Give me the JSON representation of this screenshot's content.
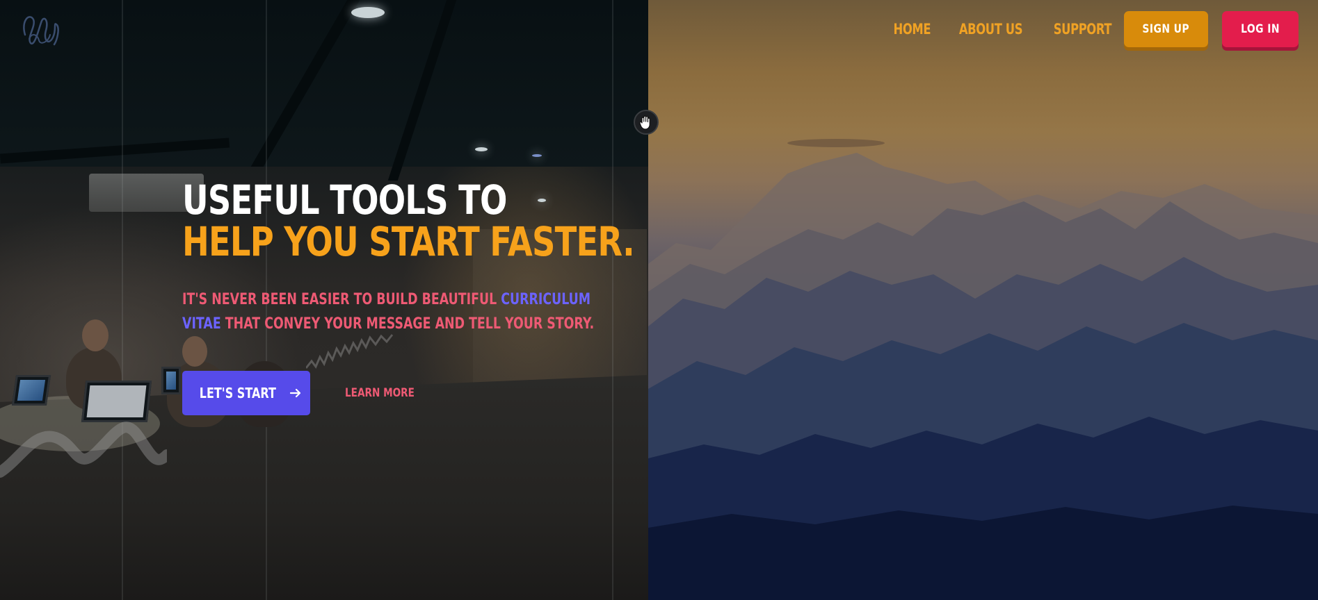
{
  "nav": {
    "links": [
      "HOME",
      "ABOUT US",
      "SUPPORT"
    ],
    "signup_label": "SIGN UP",
    "login_label": "LOG IN"
  },
  "hero": {
    "title_line1": "USEFUL TOOLS TO",
    "title_line2": "HELP YOU START FASTER.",
    "desc_before": "IT'S NEVER BEEN EASIER TO BUILD BEAUTIFUL ",
    "desc_highlight": "CURRICULUM VITAE",
    "desc_after": " THAT CONVEY YOUR MESSAGE AND TELL YOUR STORY.",
    "primary_cta": "LET'S START",
    "secondary_cta": "LEARN MORE"
  },
  "colors": {
    "nav_link": "#f0a224",
    "signup_bg": "#d88b0b",
    "login_bg": "#e31d4c",
    "title_accent": "#f7a21b",
    "desc_text": "#ee5a74",
    "highlight": "#6c63ff",
    "primary_button": "#564bea"
  },
  "icons": {
    "logo": "scribble-logo-icon",
    "arrow": "arrow-right-icon",
    "cursor": "grab-hand-cursor-icon"
  }
}
